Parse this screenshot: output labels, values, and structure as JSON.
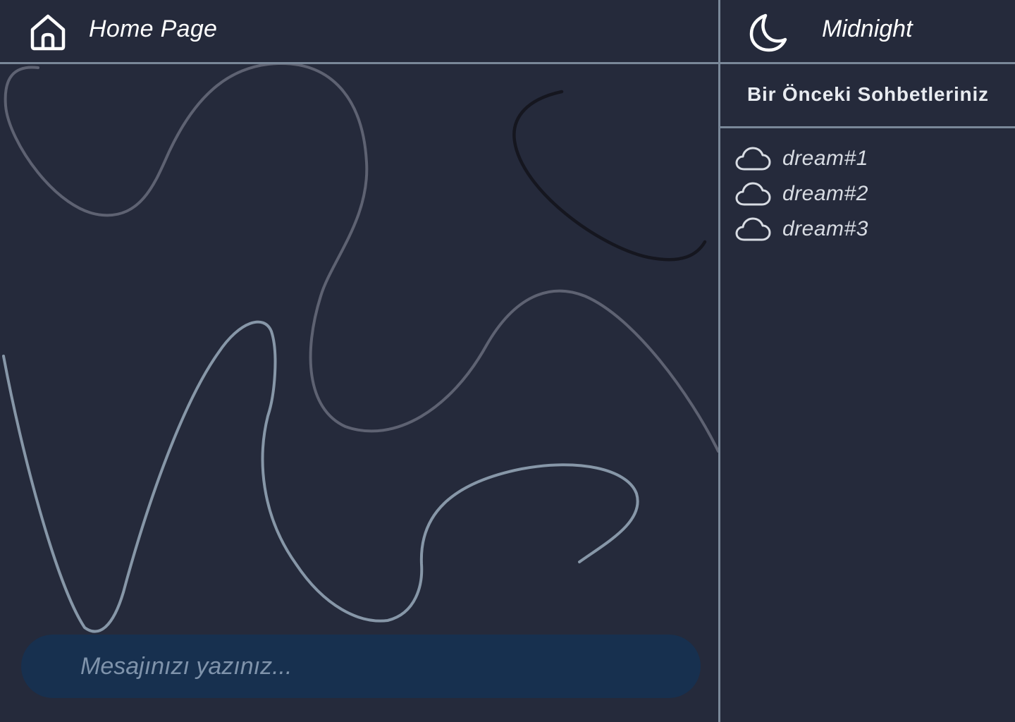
{
  "header": {
    "title": "Home Page"
  },
  "composer": {
    "placeholder": "Mesajınızı yazınız..."
  },
  "sidebar": {
    "theme_label": "Midnight",
    "section_title": "Bir Önceki Sohbetleriniz",
    "history": [
      {
        "label": "dream#1",
        "icon": "cloud-icon"
      },
      {
        "label": "dream#2",
        "icon": "cloud-icon"
      },
      {
        "label": "dream#3",
        "icon": "cloud-icon"
      }
    ]
  },
  "icons": {
    "home": "home-icon",
    "theme": "moon-icon"
  },
  "colors": {
    "background": "#252a3b",
    "border": "#7a8899",
    "composer": "#17304f",
    "placeholder": "#7f93ab",
    "curve_gray": "#5e6272",
    "curve_blue": "#8797a8",
    "curve_dark": "#15161f"
  }
}
